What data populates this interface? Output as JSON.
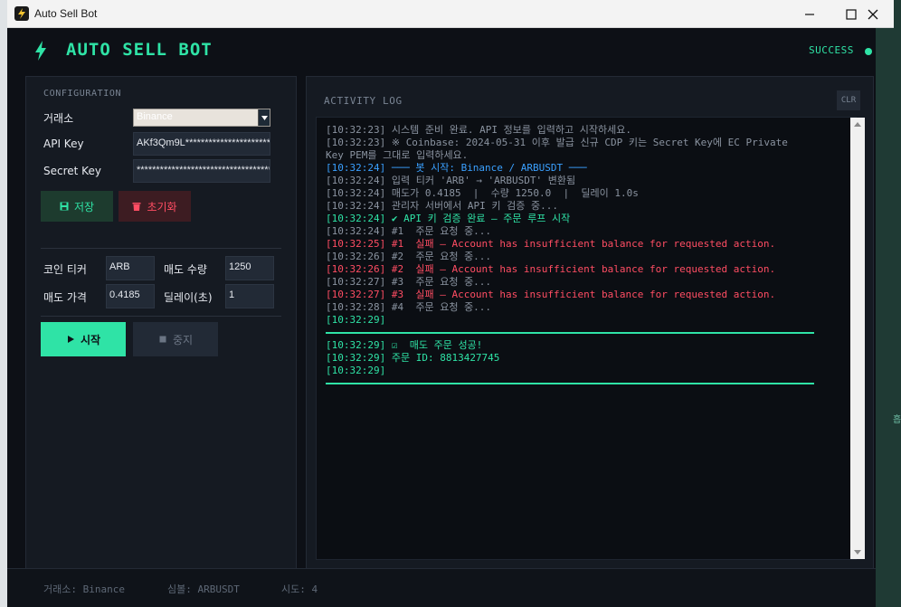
{
  "window": {
    "title": "Auto Sell Bot"
  },
  "header": {
    "brand": "AUTO SELL BOT",
    "status": "SUCCESS",
    "accent": "#2fe3a6"
  },
  "config": {
    "section_label": "CONFIGURATION",
    "exchange_label": "거래소",
    "exchange_value": "Binance",
    "api_key_label": "API Key",
    "api_key_value": "AKf3Qm9L**************************",
    "secret_key_label": "Secret Key",
    "secret_key_value": "**************************************",
    "save_label": "저장",
    "reset_label": "초기화"
  },
  "trade": {
    "ticker_label": "코인 티커",
    "ticker_value": "ARB",
    "qty_label": "매도 수량",
    "qty_value": "1250",
    "price_label": "매도 가격",
    "price_value": "0.4185",
    "delay_label": "딜레이(초)",
    "delay_value": "1",
    "start_label": "시작",
    "stop_label": "중지"
  },
  "log": {
    "title": "ACTIVITY LOG",
    "clear_label": "CLR",
    "lines": [
      {
        "text": "[10:32:23] 시스템 준비 완료. API 정보를 입력하고 시작하세요.",
        "color": "gray"
      },
      {
        "text": "[10:32:23] ※ Coinbase: 2024-05-31 이후 발급 신규 CDP 키는 Secret Key에 EC Private",
        "color": "gray"
      },
      {
        "text": "Key PEM를 그대로 입력하세요.",
        "color": "gray"
      },
      {
        "text": "[10:32:24] ─── 봇 시작: Binance / ARBUSDT ───",
        "color": "blue"
      },
      {
        "text": "[10:32:24] 입력 티커 'ARB' → 'ARBUSDT' 변환됨",
        "color": "gray"
      },
      {
        "text": "[10:32:24] 매도가 0.4185  |  수량 1250.0  |  딜레이 1.0s",
        "color": "gray"
      },
      {
        "text": "[10:32:24] 관리자 서버에서 API 키 검증 중...",
        "color": "gray"
      },
      {
        "text": "[10:32:24] ✔ API 키 검증 완료 — 주문 루프 시작",
        "color": "green"
      },
      {
        "text": "[10:32:24] #1  주문 요청 중...",
        "color": "gray"
      },
      {
        "text": "[10:32:25] #1  실패 — Account has insufficient balance for requested action.",
        "color": "red"
      },
      {
        "text": "[10:32:26] #2  주문 요청 중...",
        "color": "gray"
      },
      {
        "text": "[10:32:26] #2  실패 — Account has insufficient balance for requested action.",
        "color": "red"
      },
      {
        "text": "[10:32:27] #3  주문 요청 중...",
        "color": "gray"
      },
      {
        "text": "[10:32:27] #3  실패 — Account has insufficient balance for requested action.",
        "color": "red"
      },
      {
        "text": "[10:32:28] #4  주문 요청 중...",
        "color": "gray"
      },
      {
        "text": "[10:32:29]",
        "color": "green"
      }
    ],
    "success_lines": [
      {
        "text": "[10:32:29] ☑  매도 주문 성공!",
        "color": "green"
      },
      {
        "text": "[10:32:29] 주문 ID: 8813427745",
        "color": "green"
      },
      {
        "text": "[10:32:29]",
        "color": "green"
      }
    ]
  },
  "footer": {
    "exchange": "거래소: Binance",
    "symbol": "심볼: ARBUSDT",
    "attempts": "시도: 4"
  }
}
